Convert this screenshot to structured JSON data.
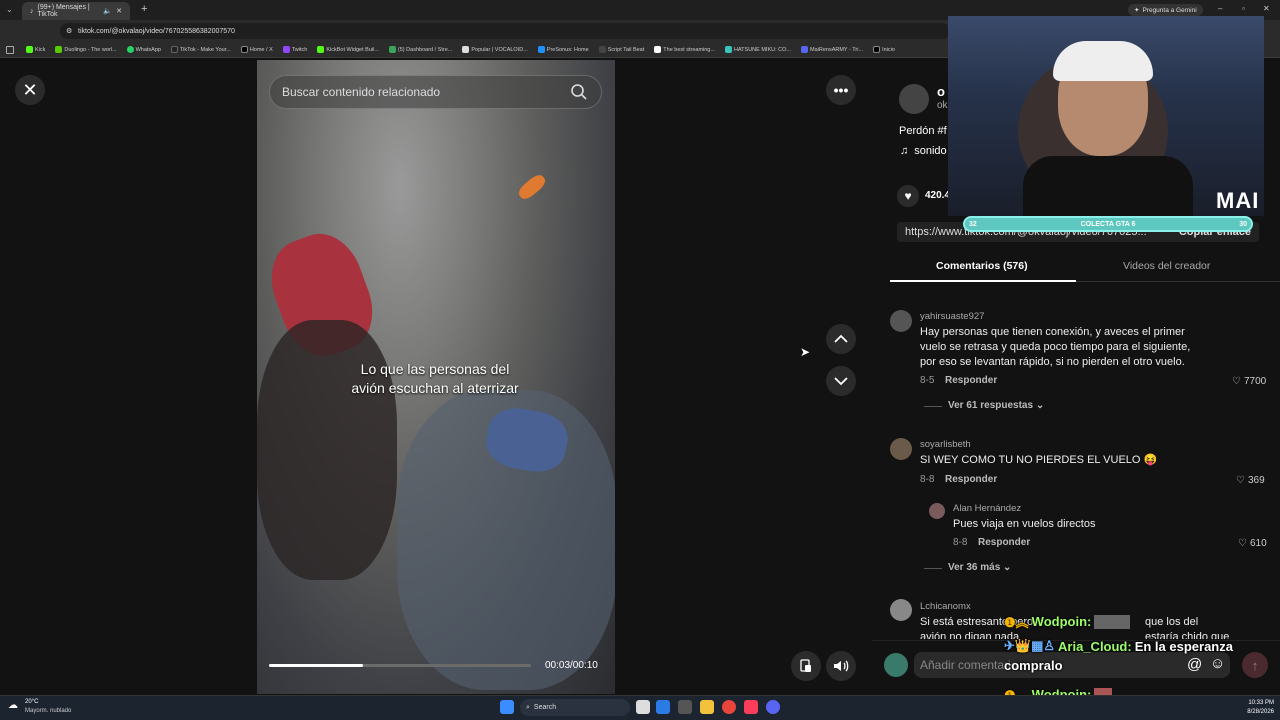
{
  "browser": {
    "tab_title": "(99+) Mensajes | TikTok",
    "new_tab": "+",
    "gemini": "Pregunta a Gemini",
    "url": "tiktok.com/@okvalaoj/video/7670255863820075​70",
    "bookmarks": [
      "Kick",
      "Duolingo - The worl...",
      "WhatsApp",
      "TikTok - Make Your...",
      "Home / X",
      "Twitch",
      "KickBot Widget Buil...",
      "(5) Dashboard / Stre...",
      "Popular | VOCALOID...",
      "PreSonus: Home",
      "Script Tail Beat",
      "The best streaming...",
      "HATSUNE MIKU: CO...",
      "MaiRensARMY - Tri...",
      "Inicio"
    ]
  },
  "video": {
    "search_placeholder": "Buscar contenido relacionado",
    "caption_line1": "Lo que las personas del",
    "caption_line2": "avión escuchan al aterrizar",
    "time": "00:03/00:10",
    "progress": 0.36
  },
  "post": {
    "author_initial": "o",
    "author_sub": "ok",
    "desc": "Perdón #f",
    "sound": "sonido",
    "likes": "420.4",
    "link": "https://www.tiktok.com/@okvalaoj/video/767025...",
    "copy_link": "Copiar enlace"
  },
  "tabs": {
    "comments": "Comentarios (576)",
    "creator_videos": "Videos del creador"
  },
  "comments": [
    {
      "user": "yahirsuaste927",
      "text": [
        "Hay personas que tienen conexión, y aveces el primer",
        "vuelo se retrasa y queda poco tiempo para el siguiente,",
        "por eso se levantan rápido, si no pierden el otro vuelo."
      ],
      "date": "8-5",
      "reply": "Responder",
      "likes": "7700",
      "replies": "Ver 61 respuestas"
    },
    {
      "user": "soyarlisbeth",
      "text": [
        "SI WEY COMO TU NO PIERDES EL VUELO 😝"
      ],
      "date": "8-8",
      "reply": "Responder",
      "likes": "369"
    },
    {
      "user": "Alan Hernández",
      "text": [
        "Pues viaja en vuelos directos"
      ],
      "date": "8-8",
      "reply": "Responder",
      "likes": "610",
      "replies": "Ver 36 más"
    },
    {
      "user": "Lchicanomx",
      "text": [
        "Si está estresante pero",
        "avión no digan nada"
      ],
      "text_right": [
        "que los del",
        "estaría chido que"
      ]
    }
  ],
  "comment_input": {
    "placeholder": "Añadir comentario..."
  },
  "stream": {
    "goal_left": "32",
    "goal_label": "COLECTA GTA 6",
    "goal_right": "30",
    "brand": "MAI"
  },
  "chat": [
    {
      "name": "Wodpoin:",
      "msg": "",
      "color": "#9cff6a"
    },
    {
      "name": "Aria_Cloud:",
      "msg": "En la esperanza",
      "msg2": "compralo",
      "color": "#9cff6a"
    },
    {
      "name": "Wodpoin:",
      "msg": "",
      "color": "#9cff6a"
    }
  ],
  "taskbar": {
    "weather_temp": "20°C",
    "weather_desc": "Mayorm. nublado",
    "search": "Search",
    "time": "10:33 PM",
    "date": "8/28/2026"
  }
}
